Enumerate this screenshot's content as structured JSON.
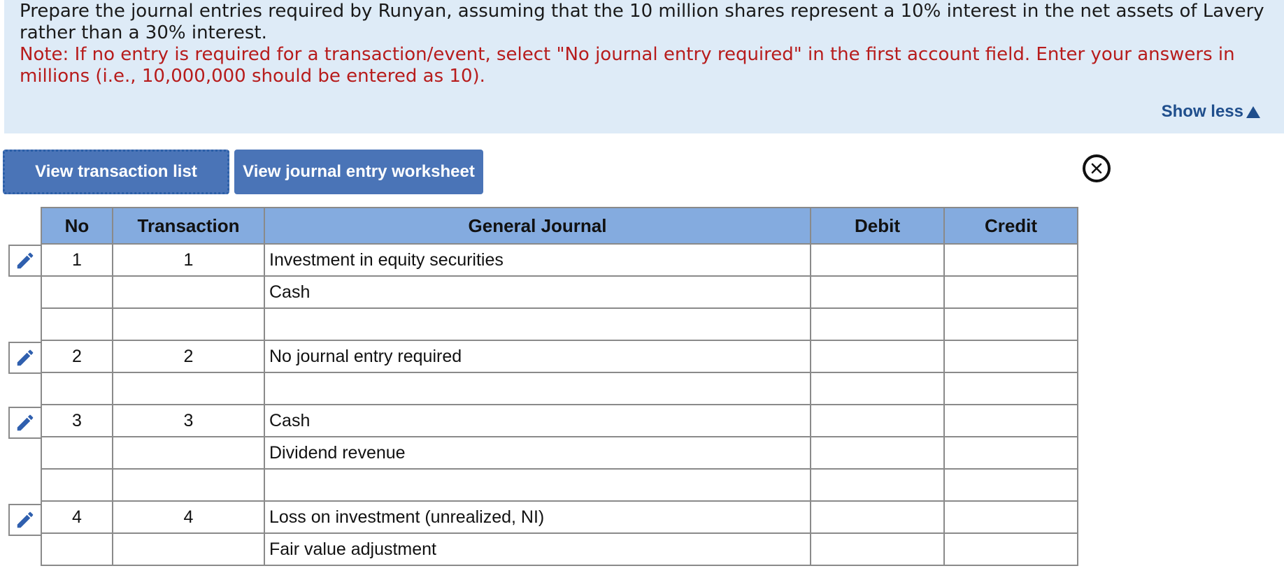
{
  "instructions": {
    "prompt": "Prepare the journal entries required by Runyan, assuming that the 10 million shares represent a 10% interest in the net assets of Lavery rather than a 30% interest.",
    "note": "Note: If no entry is required for a transaction/event, select \"No journal entry required\" in the first account field. Enter your answers in millions (i.e., 10,000,000 should be entered as 10).",
    "show_less_label": "Show less"
  },
  "buttons": {
    "view_transaction_list": "View transaction list",
    "view_journal_worksheet": "View journal entry worksheet"
  },
  "table": {
    "headers": {
      "no": "No",
      "transaction": "Transaction",
      "general_journal": "General Journal",
      "debit": "Debit",
      "credit": "Credit"
    },
    "rows": [
      {
        "no": "1",
        "transaction": "1",
        "account": "Investment in equity securities",
        "debit": "",
        "credit": ""
      },
      {
        "no": "",
        "transaction": "",
        "account": "Cash",
        "debit": "",
        "credit": ""
      },
      {
        "no": "",
        "transaction": "",
        "account": "",
        "debit": "",
        "credit": ""
      },
      {
        "no": "2",
        "transaction": "2",
        "account": "No journal entry required",
        "debit": "",
        "credit": ""
      },
      {
        "no": "",
        "transaction": "",
        "account": "",
        "debit": "",
        "credit": ""
      },
      {
        "no": "3",
        "transaction": "3",
        "account": "Cash",
        "debit": "",
        "credit": ""
      },
      {
        "no": "",
        "transaction": "",
        "account": "Dividend revenue",
        "debit": "",
        "credit": ""
      },
      {
        "no": "",
        "transaction": "",
        "account": "",
        "debit": "",
        "credit": ""
      },
      {
        "no": "4",
        "transaction": "4",
        "account": "Loss on investment (unrealized, NI)",
        "debit": "",
        "credit": ""
      },
      {
        "no": "",
        "transaction": "",
        "account": "Fair value adjustment",
        "debit": "",
        "credit": ""
      }
    ]
  },
  "icons": {
    "edit": "pencil-icon",
    "close": "close-circle-icon",
    "show_less": "triangle-up-icon"
  },
  "colors": {
    "instructions_bg": "#deebf7",
    "note_text": "#b71c1c",
    "button_bg": "#4a74b7",
    "header_bg": "#84abdf",
    "link_text": "#1f4e8c"
  }
}
